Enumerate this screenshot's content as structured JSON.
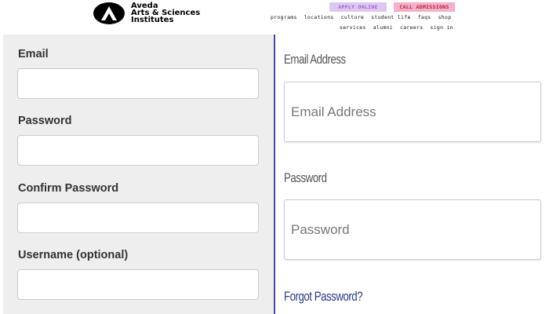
{
  "header": {
    "logo_lines": [
      "Aveda",
      "Arts & Sciences",
      "Institutes"
    ],
    "apply_label": "APPLY ONLINE",
    "admissions_label": "CALL ADMISSIONS",
    "nav_primary": [
      "programs",
      "locations",
      "culture",
      "student life",
      "faqs",
      "shop"
    ],
    "nav_secondary": [
      "services",
      "alumni",
      "careers",
      "sign in"
    ]
  },
  "left_form": {
    "email_label": "Email",
    "password_label": "Password",
    "confirm_label": "Confirm Password",
    "username_label": "Username (optional)"
  },
  "right_form": {
    "email_label": "Email Address",
    "email_placeholder": "Email Address",
    "password_label": "Password",
    "password_placeholder": "Password",
    "forgot_link": "Forgot Password?"
  },
  "colors": {
    "apply_bg": "#dcc9f2",
    "admissions_bg": "#f4b0cd",
    "divider": "#4a48a8",
    "link": "#2b3a8f"
  },
  "icons": {
    "logo": "aveda-a-logo-icon"
  }
}
